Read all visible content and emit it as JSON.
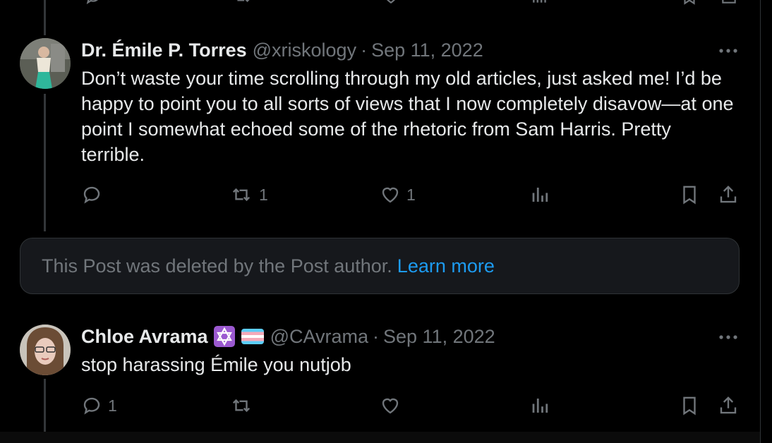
{
  "tweet1": {
    "name": "Dr. Émile P. Torres",
    "handle": "@xriskology",
    "separator": "·",
    "date": "Sep 11, 2022",
    "text": "Don’t waste your time scrolling through my old articles, just asked me! I’d be happy to point you to all sorts of views that I now completely disavow—at one point I somewhat echoed some of the rhetoric from Sam Harris. Pretty terrible.",
    "reply_count": "",
    "retweet_count": "1",
    "like_count": "1"
  },
  "deleted_notice": {
    "text": "This Post was deleted by the Post author.",
    "link": "Learn more"
  },
  "tweet2": {
    "name": "Chloe Avrama",
    "badges": [
      "star-of-david-emoji",
      "transgender-flag-emoji"
    ],
    "handle": "@CAvrama",
    "separator": "·",
    "date": "Sep 11, 2022",
    "text": "stop harassing Émile you nutjob",
    "reply_count": "1",
    "retweet_count": "",
    "like_count": ""
  },
  "icons": [
    "reply-icon",
    "retweet-icon",
    "like-icon",
    "views-icon",
    "bookmark-icon",
    "share-icon",
    "more-icon"
  ],
  "colors": {
    "background": "#000000",
    "text": "#e7e9ea",
    "muted": "#71767b",
    "link": "#1d9bf0",
    "card": "#16181c"
  }
}
